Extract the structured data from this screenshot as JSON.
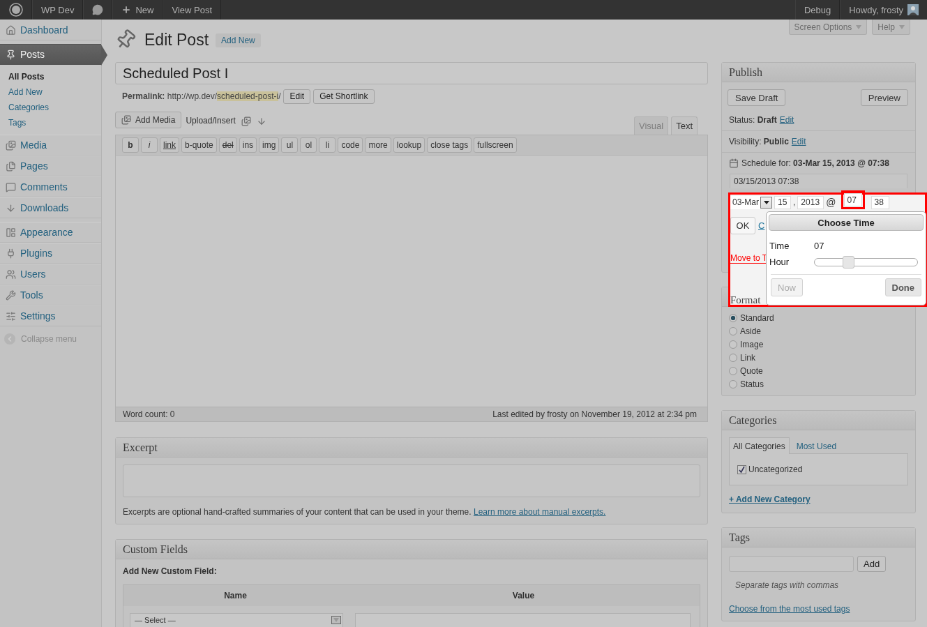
{
  "admin_bar": {
    "site": "WP Dev",
    "new": "New",
    "view": "View Post",
    "debug": "Debug",
    "greeting": "Howdy, frosty"
  },
  "screen_meta": [
    {
      "label": "Screen Options"
    },
    {
      "label": "Help"
    }
  ],
  "sidebar": {
    "items": [
      {
        "label": "Dashboard",
        "selected": false
      },
      {
        "label": "Posts",
        "selected": true,
        "children": [
          {
            "label": "All Posts",
            "selected": true
          },
          {
            "label": "Add New",
            "selected": false
          },
          {
            "label": "Categories",
            "selected": false
          },
          {
            "label": "Tags",
            "selected": false
          }
        ]
      },
      {
        "label": "Media",
        "selected": false
      },
      {
        "label": "Pages",
        "selected": false
      },
      {
        "label": "Comments",
        "selected": false
      },
      {
        "label": "Downloads",
        "selected": false
      },
      {
        "label": "Appearance",
        "selected": false
      },
      {
        "label": "Plugins",
        "selected": false
      },
      {
        "label": "Users",
        "selected": false
      },
      {
        "label": "Tools",
        "selected": false
      },
      {
        "label": "Settings",
        "selected": false
      }
    ],
    "collapse": "Collapse menu"
  },
  "header": {
    "title": "Edit Post",
    "add_new": "Add New"
  },
  "post_title": "Scheduled Post I",
  "permalink": {
    "label": "Permalink:",
    "base": "http://wp.dev/",
    "slug": "scheduled-post-i",
    "end": "/",
    "buttons": [
      "Edit",
      "Get Shortlink"
    ]
  },
  "media": {
    "add_media": "Add Media",
    "upload": "Upload/Insert"
  },
  "editor_tabs": [
    {
      "label": "Visual",
      "selected": false
    },
    {
      "label": "Text",
      "selected": true
    }
  ],
  "quicktags": [
    {
      "label": "b",
      "kind": "bold"
    },
    {
      "label": "i",
      "kind": "italic"
    },
    {
      "label": "link",
      "kind": "underline"
    },
    {
      "label": "b-quote",
      "kind": "plain"
    },
    {
      "label": "del",
      "kind": "strike"
    },
    {
      "label": "ins",
      "kind": "plain"
    },
    {
      "label": "img",
      "kind": "plain"
    },
    {
      "label": "ul",
      "kind": "plain"
    },
    {
      "label": "ol",
      "kind": "plain"
    },
    {
      "label": "li",
      "kind": "plain"
    },
    {
      "label": "code",
      "kind": "plain"
    },
    {
      "label": "more",
      "kind": "plain"
    },
    {
      "label": "lookup",
      "kind": "plain"
    },
    {
      "label": "close tags",
      "kind": "plain"
    },
    {
      "label": "fullscreen",
      "kind": "plain"
    }
  ],
  "status_bar": {
    "word_count": "Word count: 0",
    "last_edited": "Last edited by frosty on November 19, 2012 at 2:34 pm"
  },
  "excerpt": {
    "title": "Excerpt",
    "help": "Excerpts are optional hand-crafted summaries of your content that can be used in your theme.",
    "link": "Learn more about manual excerpts."
  },
  "custom_fields": {
    "title": "Custom Fields",
    "subtitle": "Add New Custom Field:",
    "columns": [
      "Name",
      "Value"
    ],
    "select": "— Select —"
  },
  "publish": {
    "title": "Publish",
    "save_draft": "Save Draft",
    "preview": "Preview",
    "status_label": "Status:",
    "status": "Draft",
    "status_edit": "Edit",
    "visibility_label": "Visibility:",
    "visibility": "Public",
    "visibility_edit": "Edit",
    "schedule_label": "Schedule for:",
    "schedule": "03-Mar 15, 2013 @ 07:38",
    "schedule_field": "03/15/2013 07:38"
  },
  "date_editor": {
    "month": "03-Mar",
    "day": "15",
    "day_sep": ",",
    "year": "2013",
    "at": "@",
    "hour": "07",
    "minute": "38",
    "ok": "OK",
    "cancel": "C",
    "trash": "Move to T"
  },
  "time_picker": {
    "title": "Choose Time",
    "time_label": "Time",
    "time": "07",
    "hour": {
      "label": "Hour",
      "level": 0.3
    },
    "now": {
      "label": "Now",
      "disabled": true
    },
    "done": {
      "label": "Done",
      "disabled": false
    }
  },
  "format": {
    "title": "Format",
    "options": [
      {
        "label": "Standard",
        "selected": true
      },
      {
        "label": "Aside",
        "selected": false
      },
      {
        "label": "Image",
        "selected": false
      },
      {
        "label": "Link",
        "selected": false
      },
      {
        "label": "Quote",
        "selected": false
      },
      {
        "label": "Status",
        "selected": false
      }
    ]
  },
  "categories": {
    "title": "Categories",
    "tabs": [
      {
        "label": "All Categories",
        "selected": true
      },
      {
        "label": "Most Used",
        "selected": false
      }
    ],
    "items": [
      {
        "label": "Uncategorized",
        "checked": true
      }
    ],
    "add": "+ Add New Category"
  },
  "tags": {
    "title": "Tags",
    "add": "Add",
    "hint": "Separate tags with commas",
    "link": "Choose from the most used tags"
  }
}
